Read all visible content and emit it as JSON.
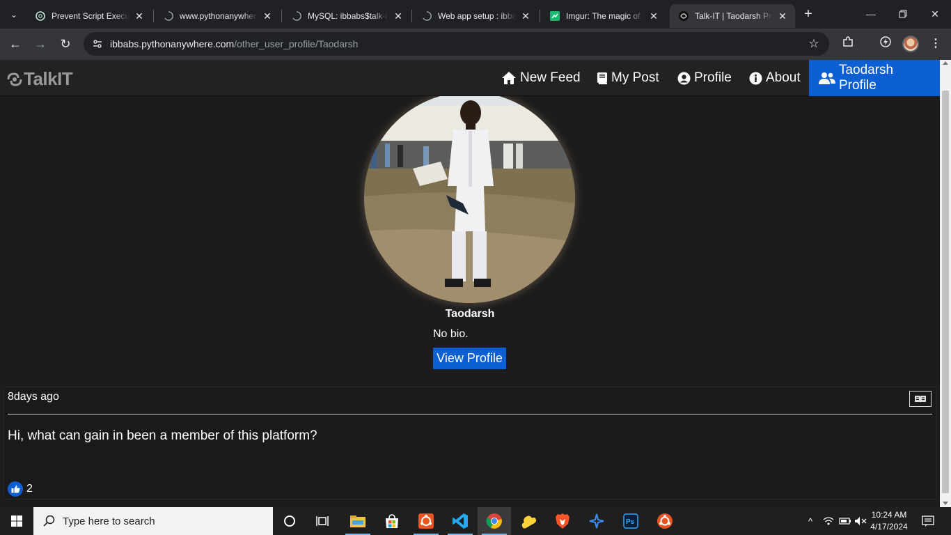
{
  "browser": {
    "tabs": [
      {
        "title": "Prevent Script Executi",
        "favicon": "openai-icon"
      },
      {
        "title": "www.pythonanywhere.c",
        "favicon": "spinner-icon"
      },
      {
        "title": "MySQL: ibbabs$talk-it",
        "favicon": "spinner-icon"
      },
      {
        "title": "Web app setup : ibbab",
        "favicon": "spinner-icon"
      },
      {
        "title": "Imgur: The magic of th",
        "favicon": "imgur-icon"
      },
      {
        "title": "Talk-IT | Taodarsh Pro",
        "favicon": "talkit-icon",
        "active": true
      }
    ],
    "url_domain": "ibbabs.pythonanywhere.com",
    "url_path": "/other_user_profile/Taodarsh"
  },
  "site": {
    "logo_text": "TalkIT",
    "nav": {
      "new_feed": "New Feed",
      "my_post": "My Post",
      "profile": "Profile",
      "about": "About",
      "user_profile": "Taodarsh Profile"
    },
    "accent_color": "#0c5fd3"
  },
  "profile": {
    "username": "Taodarsh",
    "bio": "No bio.",
    "view_profile_label": "View Profile"
  },
  "post": {
    "time": "8days ago",
    "content": "Hi, what can gain in been a member of this platform?",
    "likes": "2"
  },
  "taskbar": {
    "search_placeholder": "Type here to search",
    "time": "10:24 AM",
    "date": "4/17/2024"
  }
}
